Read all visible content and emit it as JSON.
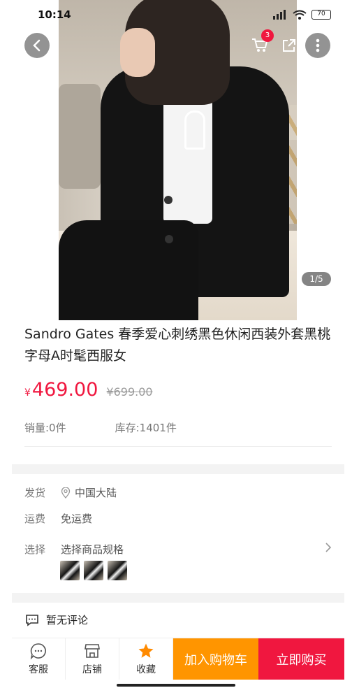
{
  "status_bar": {
    "time": "10:14",
    "battery": "70"
  },
  "nav": {
    "cart_count": "3",
    "icons": [
      "chevron-left-icon",
      "cart-icon",
      "share-icon",
      "more-vertical-icon"
    ]
  },
  "gallery": {
    "indicator": "1/5"
  },
  "product": {
    "title": "Sandro Gates 春季爱心刺绣黑色休闲西装外套黑桃字母A时髦西服女",
    "currency": "¥",
    "price": "469.00",
    "original_price": "¥699.00",
    "sales": "销量:0件",
    "stock": "库存:1401件"
  },
  "shipping": {
    "ship_label": "发货",
    "ship_value": "中国大陆",
    "fee_label": "运费",
    "fee_value": "免运费",
    "select_label": "选择",
    "select_value": "选择商品规格"
  },
  "review": {
    "text": "暂无评论"
  },
  "bottom_bar": {
    "service": "客服",
    "shop": "店铺",
    "favorite": "收藏",
    "add_to_cart": "加入购物车",
    "buy_now": "立即购买"
  },
  "colors": {
    "accent_red": "#f0173f",
    "accent_orange": "#ff9500",
    "favorite_star": "#ff8a00"
  }
}
